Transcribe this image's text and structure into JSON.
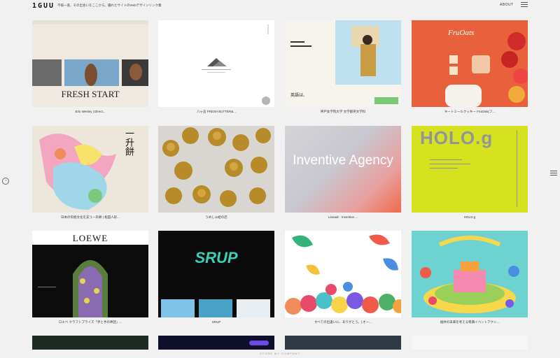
{
  "header": {
    "logo": "1GUU",
    "tagline": "不揃一進、その出会いをここから。優れたサイトのWebデザインリンク集",
    "about": "ABOUT"
  },
  "cards": [
    {
      "caption": "Erlo Wesley | Direct...",
      "thumb_text": "FRESH START"
    },
    {
      "caption": "八ヶ岳 FRESH BUTTER&...",
      "thumb_text": ""
    },
    {
      "caption": "神戸女学院大学 文学部英文学科",
      "thumb_text": "英語は、"
    },
    {
      "caption": "キートミールクッキー FruOats(フ...",
      "thumb_text": "FruOats"
    },
    {
      "caption": "日本の伝統文化を支う一升餅 | 松田人形...",
      "thumb_text": "一升餅"
    },
    {
      "caption": "うめしゅ絵の店",
      "thumb_text": ""
    },
    {
      "caption": "Lineadr · Inventive ...",
      "thumb_text": "Inventive Agency"
    },
    {
      "caption": "HOLO.g",
      "thumb_text": "HOLO.g"
    },
    {
      "caption": "ロエベ クラフトプライズ「手と手の神話」...",
      "thumb_text": "LOEWE"
    },
    {
      "caption": "SRUP",
      "thumb_text": "SRUP"
    },
    {
      "caption": "すべての出逢いに、ありがとう。| オー...",
      "thumb_text": ""
    },
    {
      "caption": "福井の未来を考える祭典イベントアクシ...",
      "thumb_text": ""
    }
  ],
  "footer": {
    "text": "STORE MY COMPANY"
  },
  "colors": {
    "bg": "#f1f1f1",
    "holo": "#d6e21f",
    "fruoats": "#e8603c"
  }
}
